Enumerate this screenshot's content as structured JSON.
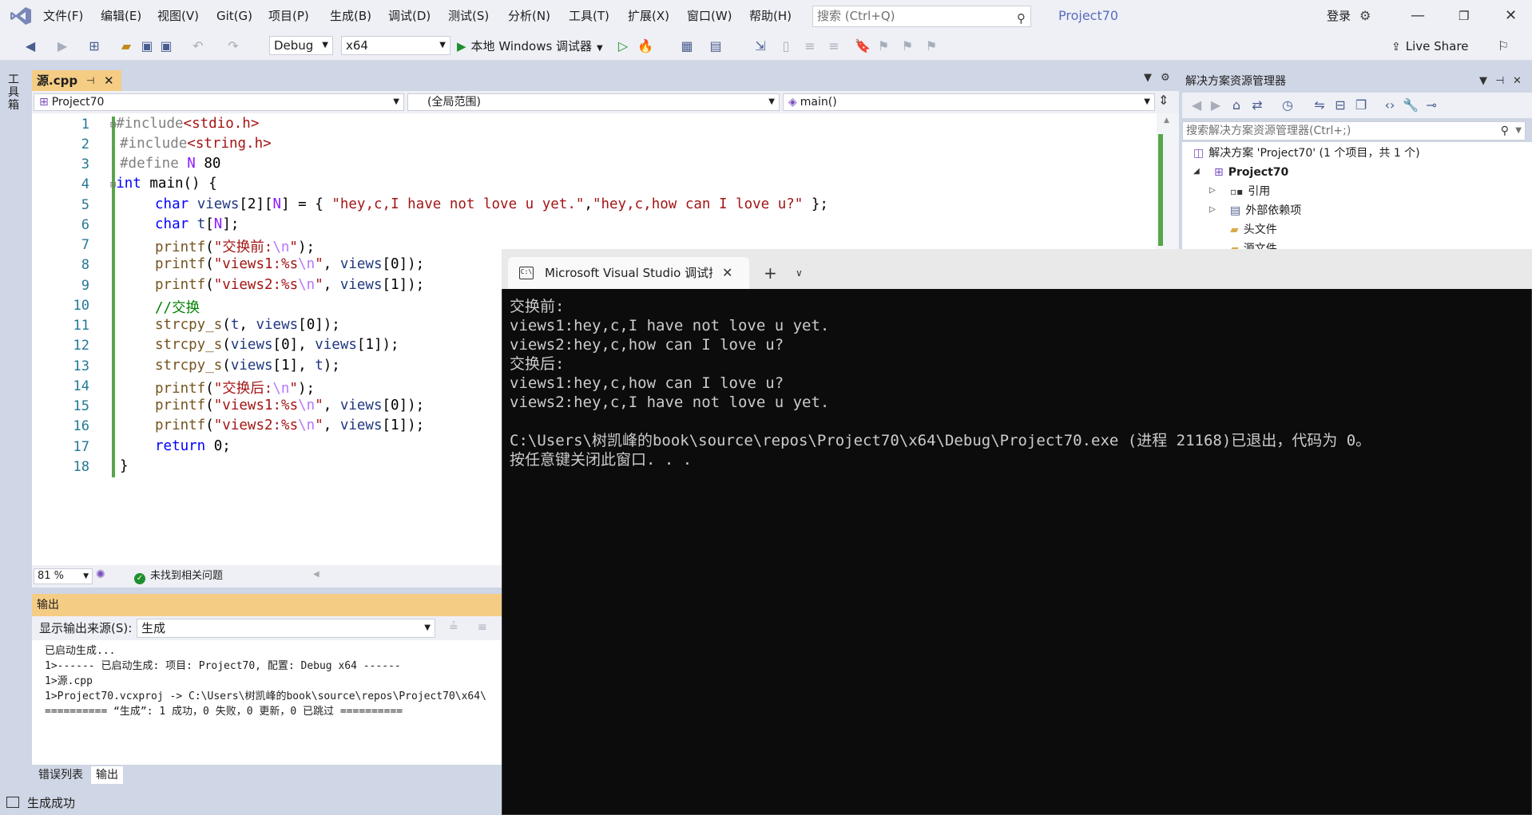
{
  "menubar": {
    "items": [
      "文件(F)",
      "编辑(E)",
      "视图(V)",
      "Git(G)",
      "项目(P)",
      "生成(B)",
      "调试(D)",
      "测试(S)",
      "分析(N)",
      "工具(T)",
      "扩展(X)",
      "窗口(W)",
      "帮助(H)"
    ],
    "search_placeholder": "搜索 (Ctrl+Q)",
    "project_title": "Project70",
    "login": "登录"
  },
  "toolbar": {
    "config": "Debug",
    "platform": "x64",
    "run_label": "本地 Windows 调试器",
    "live_share": "Live Share"
  },
  "toolbox_label": "工具箱",
  "editor": {
    "tab_name": "源.cpp",
    "nav_project": "Project70",
    "nav_scope": "(全局范围)",
    "nav_member": "main()",
    "line_numbers": [
      "1",
      "2",
      "3",
      "4",
      "5",
      "6",
      "7",
      "8",
      "9",
      "10",
      "11",
      "12",
      "13",
      "14",
      "15",
      "16",
      "17",
      "18"
    ],
    "zoom": "81 %",
    "issues": "未找到相关问题"
  },
  "code": {
    "l1": [
      "#include",
      "<stdio.h>"
    ],
    "l2": [
      "#include",
      "<string.h>"
    ],
    "l3": [
      "#define ",
      "N",
      " 80"
    ],
    "l4": [
      "int",
      " main() {"
    ],
    "l5": [
      "char",
      " ",
      "views",
      "[2][",
      "N",
      "] = { ",
      "\"hey,c,I have not love u yet.\"",
      ",",
      "\"hey,c,how can I love u?\"",
      " };"
    ],
    "l6": [
      "char",
      " ",
      "t",
      "[",
      "N",
      "];"
    ],
    "l7": [
      "printf",
      "(",
      "\"交换前:",
      "\\n",
      "\"",
      ");"
    ],
    "l8": [
      "printf",
      "(",
      "\"views1:%s",
      "\\n",
      "\"",
      ", ",
      "views",
      "[0]);"
    ],
    "l9": [
      "printf",
      "(",
      "\"views2:%s",
      "\\n",
      "\"",
      ", ",
      "views",
      "[1]);"
    ],
    "l10": [
      "//交换"
    ],
    "l11": [
      "strcpy_s",
      "(",
      "t",
      ", ",
      "views",
      "[0]);"
    ],
    "l12": [
      "strcpy_s",
      "(",
      "views",
      "[0], ",
      "views",
      "[1]);"
    ],
    "l13": [
      "strcpy_s",
      "(",
      "views",
      "[1], ",
      "t",
      ");"
    ],
    "l14": [
      "printf",
      "(",
      "\"交换后:",
      "\\n",
      "\"",
      ");"
    ],
    "l15": [
      "printf",
      "(",
      "\"views1:%s",
      "\\n",
      "\"",
      ", ",
      "views",
      "[0]);"
    ],
    "l16": [
      "printf",
      "(",
      "\"views2:%s",
      "\\n",
      "\"",
      ", ",
      "views",
      "[1]);"
    ],
    "l17": [
      "return",
      " 0;"
    ],
    "l18": [
      "}"
    ]
  },
  "output": {
    "header": "输出",
    "source_label": "显示输出来源(S):",
    "source_value": "生成",
    "lines": [
      "已启动生成...",
      "1>------ 已启动生成: 项目: Project70, 配置: Debug x64 ------",
      "1>源.cpp",
      "1>Project70.vcxproj -> C:\\Users\\树凯峰的book\\source\\repos\\Project70\\x64\\",
      "========== “生成”: 1 成功，0 失败，0 更新，0 已跳过 =========="
    ],
    "tab_errors": "错误列表",
    "tab_output": "输出"
  },
  "status": {
    "text": "生成成功"
  },
  "solution_explorer": {
    "title": "解决方案资源管理器",
    "search_placeholder": "搜索解决方案资源管理器(Ctrl+;)",
    "solution_line": "解决方案 'Project70' (1 个项目，共 1 个)",
    "project": "Project70",
    "items": [
      "引用",
      "外部依赖项",
      "头文件",
      "源文件"
    ]
  },
  "console": {
    "tab_title": "Microsoft Visual Studio 调试控制台",
    "lines": [
      "交换前:",
      "views1:hey,c,I have not love u yet.",
      "views2:hey,c,how can I love u?",
      "交换后:",
      "views1:hey,c,how can I love u?",
      "views2:hey,c,I have not love u yet.",
      "",
      "C:\\Users\\树凯峰的book\\source\\repos\\Project70\\x64\\Debug\\Project70.exe (进程 21168)已退出，代码为 0。",
      "按任意键关闭此窗口. . ."
    ]
  }
}
